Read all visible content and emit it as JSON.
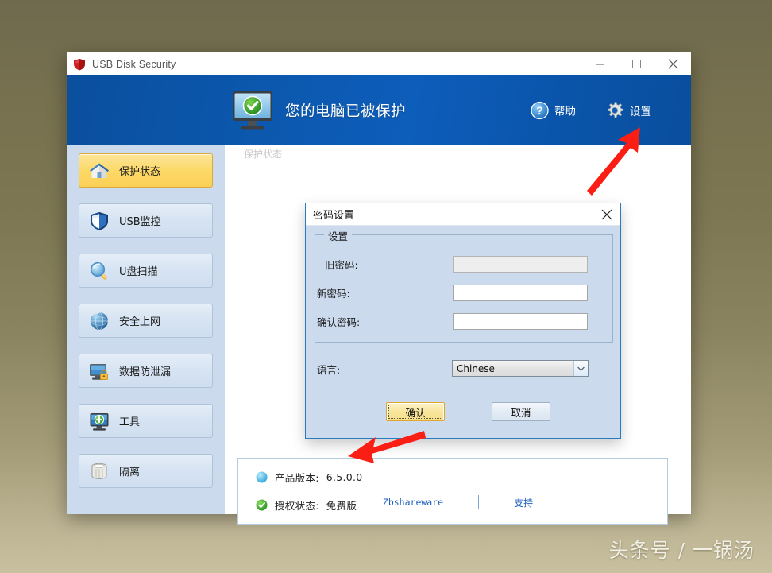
{
  "window": {
    "title": "USB Disk Security",
    "icon": "shield-icon",
    "controls": {
      "minimize": "minimize-icon",
      "maximize": "maximize-icon",
      "close": "close-icon"
    }
  },
  "header": {
    "status_text": "您的电脑已被保护",
    "status_icon": "monitor-protected-icon",
    "help_label": "帮助",
    "help_icon": "question-icon",
    "settings_label": "设置",
    "settings_icon": "gear-icon"
  },
  "sidebar": {
    "items": [
      {
        "label": "保护状态",
        "icon": "home-icon",
        "active": true
      },
      {
        "label": "USB监控",
        "icon": "shield-icon",
        "active": false
      },
      {
        "label": "U盘扫描",
        "icon": "magnifier-icon",
        "active": false
      },
      {
        "label": "安全上网",
        "icon": "globe-icon",
        "active": false
      },
      {
        "label": "数据防泄漏",
        "icon": "lock-monitor-icon",
        "active": false
      },
      {
        "label": "工具",
        "icon": "monitor-plus-icon",
        "active": false
      },
      {
        "label": "隔离",
        "icon": "trash-icon",
        "active": false
      }
    ]
  },
  "content": {
    "background_title": "保护状态",
    "info_panel": {
      "rows": [
        {
          "icon": "blue-sphere-icon",
          "label": "产品版本:",
          "value": "6.5.0.0"
        },
        {
          "icon": "green-check-icon",
          "label": "授权状态:",
          "value": "免费版"
        }
      ]
    },
    "footer": {
      "brand_link": "Zbshareware",
      "support_link": "支持"
    }
  },
  "dialog": {
    "title": "密码设置",
    "close_icon": "close-icon",
    "fieldset_legend": "设置",
    "fields": [
      {
        "label": "旧密码:",
        "value": "",
        "placeholder": "",
        "disabled": true
      },
      {
        "label": "新密码:",
        "value": "",
        "placeholder": "",
        "disabled": false
      },
      {
        "label": "确认密码:",
        "value": "",
        "placeholder": "",
        "disabled": false
      }
    ],
    "language": {
      "label": "语言:",
      "selected": "Chinese",
      "arrow_icon": "chevron-down-icon"
    },
    "buttons": {
      "ok": "确认",
      "cancel": "取消"
    }
  },
  "annotations": {
    "arrow_color": "#fa1e14",
    "arrow_to_settings": "arrow-icon",
    "arrow_to_license": "arrow-icon"
  },
  "watermark": {
    "text": "头条号 / 一锅汤"
  },
  "colors": {
    "accent_blue": "#0d5dba",
    "sidebar_bg": "#ccdaee",
    "active_item": "#fbd056",
    "link_blue": "#1f5fbf",
    "desktop_bg": "#7d7753"
  }
}
